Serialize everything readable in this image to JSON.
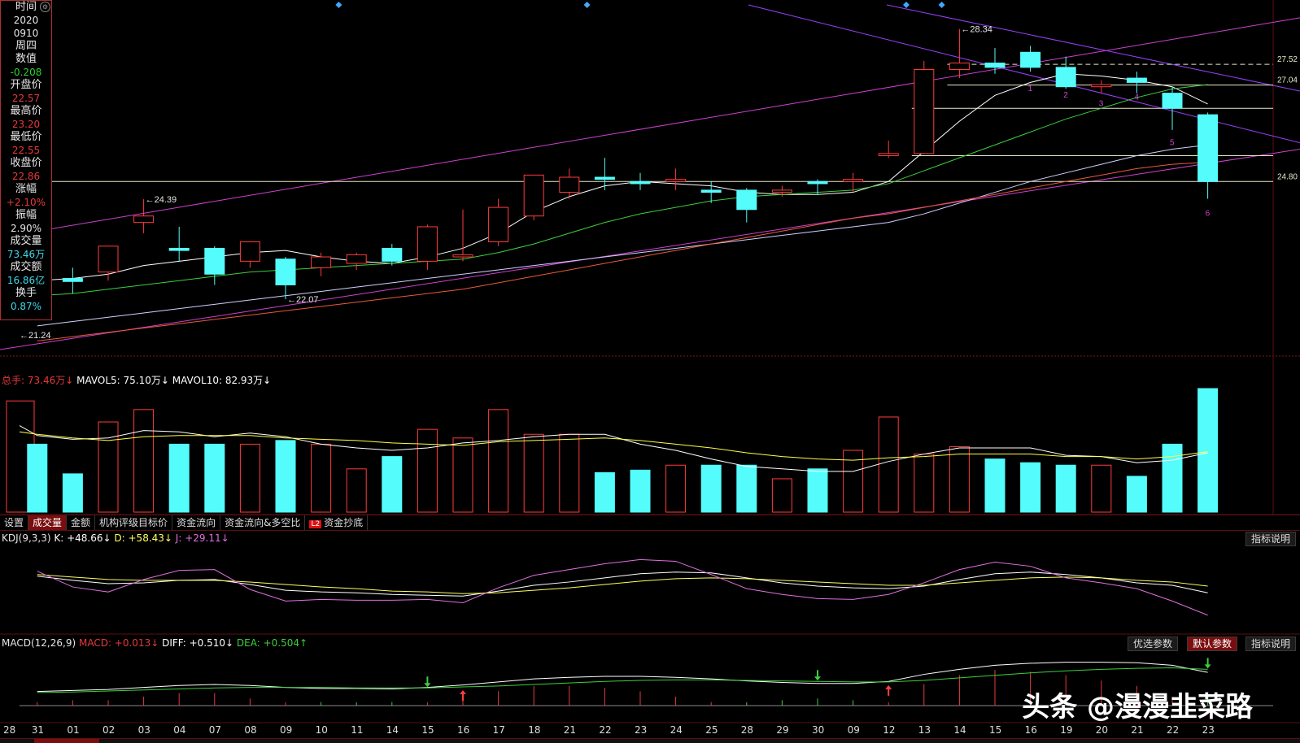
{
  "info_panel": {
    "rows": [
      {
        "label": "时间",
        "value": "2020"
      },
      {
        "label": "",
        "value": "0910"
      },
      {
        "label": "周四",
        "value": ""
      },
      {
        "label": "数值",
        "value": "-0.208"
      },
      {
        "label": "开盘价",
        "value": "22.57"
      },
      {
        "label": "最高价",
        "value": "23.20"
      },
      {
        "label": "最低价",
        "value": "22.55"
      },
      {
        "label": "收盘价",
        "value": "22.86"
      },
      {
        "label": "涨幅",
        "value": "+2.10%"
      },
      {
        "label": "振幅",
        "value": "2.90%"
      },
      {
        "label": "成交量",
        "value": "73.46万"
      },
      {
        "label": "成交额",
        "value": "16.86亿"
      },
      {
        "label": "换手",
        "value": "0.87%"
      }
    ],
    "value_colors": [
      "#e6e6e6",
      "#e6e6e6",
      "#e6e6e6",
      "#2ed52e",
      "#e53a3a",
      "#e53a3a",
      "#e53a3a",
      "#e53a3a",
      "#e53a3a",
      "#e6e6e6",
      "#3fd8e8",
      "#3fd8e8",
      "#3fd8e8"
    ]
  },
  "price_chart": {
    "y_range": [
      20.9,
      28.9
    ],
    "candles": [
      {
        "o": 22.9,
        "h": 23.6,
        "c": 22.2,
        "l": 22.0
      },
      {
        "o": 22.55,
        "h": 22.8,
        "c": 22.48,
        "l": 22.2
      },
      {
        "o": 22.7,
        "h": 23.3,
        "c": 23.3,
        "l": 22.5
      },
      {
        "o": 23.85,
        "h": 24.39,
        "c": 24.0,
        "l": 23.6
      },
      {
        "o": 23.25,
        "h": 23.75,
        "c": 23.2,
        "l": 22.95
      },
      {
        "o": 23.25,
        "h": 23.3,
        "c": 22.65,
        "l": 22.4
      },
      {
        "o": 22.95,
        "h": 23.4,
        "c": 23.4,
        "l": 22.8
      },
      {
        "o": 23.0,
        "h": 23.05,
        "c": 22.4,
        "l": 22.07
      },
      {
        "o": 22.8,
        "h": 23.15,
        "c": 23.05,
        "l": 22.6
      },
      {
        "o": 22.9,
        "h": 23.15,
        "c": 23.1,
        "l": 22.75
      },
      {
        "o": 23.25,
        "h": 23.35,
        "c": 22.95,
        "l": 22.85
      },
      {
        "o": 22.95,
        "h": 23.8,
        "c": 23.75,
        "l": 22.75
      },
      {
        "o": 23.05,
        "h": 24.15,
        "c": 23.1,
        "l": 22.95
      },
      {
        "o": 23.4,
        "h": 24.4,
        "c": 24.2,
        "l": 23.3
      },
      {
        "o": 24.0,
        "h": 24.8,
        "c": 24.95,
        "l": 23.9
      },
      {
        "o": 24.55,
        "h": 25.1,
        "c": 24.9,
        "l": 24.4
      },
      {
        "o": 24.9,
        "h": 25.35,
        "c": 24.85,
        "l": 24.6
      },
      {
        "o": 24.8,
        "h": 25.0,
        "c": 24.75,
        "l": 24.6
      },
      {
        "o": 24.8,
        "h": 25.1,
        "c": 24.85,
        "l": 24.6
      },
      {
        "o": 24.6,
        "h": 24.8,
        "c": 24.55,
        "l": 24.3
      },
      {
        "o": 24.6,
        "h": 24.65,
        "c": 24.15,
        "l": 23.85
      },
      {
        "o": 24.55,
        "h": 24.7,
        "c": 24.6,
        "l": 24.45
      },
      {
        "o": 24.8,
        "h": 24.85,
        "c": 24.75,
        "l": 24.5
      },
      {
        "o": 24.8,
        "h": 25.0,
        "c": 24.85,
        "l": 24.55
      },
      {
        "o": 25.4,
        "h": 25.75,
        "c": 25.45,
        "l": 25.35
      },
      {
        "o": 25.45,
        "h": 27.6,
        "c": 27.4,
        "l": 25.45
      },
      {
        "o": 27.4,
        "h": 28.34,
        "c": 27.55,
        "l": 27.2
      },
      {
        "o": 27.55,
        "h": 27.9,
        "c": 27.45,
        "l": 27.3
      },
      {
        "o": 27.8,
        "h": 27.95,
        "c": 27.45,
        "l": 27.35
      },
      {
        "o": 27.45,
        "h": 27.7,
        "c": 27.0,
        "l": 26.95
      },
      {
        "o": 27.0,
        "h": 27.15,
        "c": 27.05,
        "l": 26.85
      },
      {
        "o": 27.2,
        "h": 27.35,
        "c": 27.1,
        "l": 26.85
      },
      {
        "o": 26.85,
        "h": 27.0,
        "c": 26.5,
        "l": 26.0
      },
      {
        "o": 26.35,
        "h": 26.4,
        "c": 24.8,
        "l": 24.4
      }
    ],
    "ma": [
      {
        "color": "#ffffff",
        "values": [
          22.5,
          22.55,
          22.65,
          22.85,
          22.95,
          23.05,
          23.15,
          23.2,
          23.05,
          22.95,
          22.9,
          23.05,
          23.25,
          23.6,
          24.1,
          24.45,
          24.7,
          24.8,
          24.75,
          24.7,
          24.55,
          24.5,
          24.5,
          24.55,
          24.8,
          25.5,
          26.2,
          26.8,
          27.1,
          27.3,
          27.25,
          27.15,
          27.0,
          26.6
        ]
      },
      {
        "color": "#3ccf3c",
        "values": [
          22.15,
          22.2,
          22.3,
          22.4,
          22.5,
          22.6,
          22.7,
          22.75,
          22.8,
          22.85,
          22.9,
          22.95,
          23.0,
          23.15,
          23.35,
          23.6,
          23.85,
          24.05,
          24.2,
          24.35,
          24.45,
          24.5,
          24.55,
          24.6,
          24.75,
          25.05,
          25.35,
          25.65,
          25.95,
          26.25,
          26.5,
          26.75,
          26.95,
          27.05
        ]
      },
      {
        "color": "#d0d0ff",
        "values": [
          21.45,
          21.55,
          21.65,
          21.75,
          21.85,
          21.95,
          22.05,
          22.15,
          22.25,
          22.35,
          22.45,
          22.55,
          22.65,
          22.75,
          22.85,
          22.95,
          23.05,
          23.15,
          23.25,
          23.35,
          23.45,
          23.55,
          23.65,
          23.75,
          23.85,
          24.05,
          24.3,
          24.55,
          24.8,
          25.0,
          25.2,
          25.4,
          25.55,
          25.65
        ]
      },
      {
        "color": "#e85a3a",
        "values": [
          21.1,
          21.2,
          21.3,
          21.4,
          21.5,
          21.6,
          21.7,
          21.8,
          21.9,
          22.0,
          22.1,
          22.2,
          22.3,
          22.45,
          22.6,
          22.75,
          22.9,
          23.05,
          23.2,
          23.35,
          23.5,
          23.65,
          23.8,
          23.95,
          24.05,
          24.2,
          24.35,
          24.5,
          24.65,
          24.8,
          24.95,
          25.1,
          25.2,
          25.25
        ]
      }
    ],
    "extreme_labels": [
      {
        "text": "24.39",
        "index": 3,
        "price": 24.39
      },
      {
        "text": "22.07",
        "index": 7,
        "price": 22.07
      },
      {
        "text": "21.24",
        "index": -1,
        "price": 21.24
      },
      {
        "text": "28.34",
        "index": 26,
        "price": 28.34
      }
    ],
    "level_lines": [
      {
        "text": "27.52",
        "price": 27.52,
        "dashed": true,
        "start_index": 26
      },
      {
        "text": "27.04",
        "price": 27.04,
        "dashed": false,
        "start_index": 26
      },
      {
        "text": "",
        "price": 26.5,
        "dashed": false,
        "start_index": 25
      },
      {
        "text": "",
        "price": 25.4,
        "dashed": false,
        "start_index": 25
      },
      {
        "text": "24.80",
        "price": 24.8,
        "dashed": false,
        "start_index": 0
      }
    ],
    "wave_labels": [
      {
        "text": "1",
        "index": 28,
        "price": 26.9
      },
      {
        "text": "2",
        "index": 29,
        "price": 26.75
      },
      {
        "text": "3",
        "index": 30,
        "price": 26.55
      },
      {
        "text": "4",
        "index": 31,
        "price": 26.7
      },
      {
        "text": "5",
        "index": 32,
        "price": 25.65
      },
      {
        "text": "6",
        "index": 33,
        "price": 24.0
      }
    ],
    "diamonds_index": [
      8.5,
      15.5,
      24.5,
      25.5
    ]
  },
  "volume_panel": {
    "header": {
      "total_label": "总手: ",
      "total_value": "73.46万↓",
      "mavol5": "MAVOL5: 75.10万↓",
      "mavol10": "MAVOL10: 82.93万↓"
    },
    "max": 100,
    "values": [
      90,
      55,
      31,
      73,
      83,
      55,
      55,
      55,
      58,
      55,
      35,
      45,
      67,
      60,
      83,
      63,
      63,
      32,
      34,
      38,
      38,
      38,
      27,
      35,
      50,
      77,
      47,
      53,
      43,
      40,
      38,
      38,
      29,
      55,
      100
    ],
    "ma5": [
      70,
      62,
      59,
      60,
      66,
      65,
      61,
      64,
      61,
      55,
      52,
      50,
      52,
      56,
      58,
      61,
      63,
      63,
      55,
      50,
      43,
      37,
      35,
      33,
      33,
      41,
      47,
      52,
      52,
      52,
      46,
      45,
      40,
      42,
      48
    ],
    "ma10": [
      65,
      63,
      60,
      58,
      61,
      62,
      62,
      62,
      60,
      59,
      58,
      56,
      55,
      54,
      57,
      58,
      59,
      60,
      58,
      55,
      52,
      48,
      45,
      43,
      42,
      44,
      45,
      47,
      47,
      47,
      45,
      45,
      43,
      45,
      49
    ]
  },
  "tabs": {
    "items": [
      "设置",
      "成交量",
      "金额",
      "机构评级目标价",
      "资金流向",
      "资金流向&多空比",
      "资金抄底"
    ],
    "active_index": 1,
    "l2_badge": "L2"
  },
  "kdj_panel": {
    "header": {
      "name": "KDJ(9,3,3)",
      "k": "K: +48.66↓",
      "d": "D: +58.43↓",
      "j": "J: +29.11↓"
    },
    "explain_btn": "指标说明",
    "k": [
      60,
      55,
      51,
      52,
      55,
      56,
      50,
      43,
      41,
      40,
      38,
      37,
      36,
      42,
      49,
      53,
      58,
      63,
      65,
      64,
      58,
      52,
      48,
      46,
      45,
      48,
      56,
      63,
      65,
      62,
      58,
      52,
      49,
      40
    ],
    "d": [
      62,
      59,
      56,
      55,
      55,
      55,
      53,
      50,
      47,
      45,
      42,
      41,
      39,
      40,
      43,
      46,
      50,
      54,
      57,
      58,
      57,
      55,
      53,
      51,
      49,
      49,
      52,
      55,
      58,
      59,
      58,
      55,
      53,
      48
    ],
    "j": [
      66,
      47,
      41,
      56,
      67,
      68,
      44,
      30,
      32,
      31,
      31,
      32,
      28,
      46,
      61,
      68,
      75,
      80,
      78,
      62,
      45,
      38,
      33,
      32,
      38,
      52,
      68,
      77,
      72,
      58,
      52,
      45,
      30,
      13
    ],
    "range": [
      0,
      100
    ]
  },
  "macd_panel": {
    "header": {
      "name": "MACD(12,26,9)",
      "macd": "MACD: +0.013↓",
      "diff": "DIFF: +0.510↓",
      "dea": "DEA: +0.504↑"
    },
    "buttons": {
      "preferred": "优选参数",
      "default": "默认参数",
      "explain": "指标说明"
    },
    "diff": [
      0.28,
      0.3,
      0.32,
      0.36,
      0.4,
      0.42,
      0.4,
      0.36,
      0.34,
      0.34,
      0.33,
      0.36,
      0.41,
      0.47,
      0.53,
      0.56,
      0.58,
      0.58,
      0.56,
      0.53,
      0.49,
      0.46,
      0.44,
      0.44,
      0.48,
      0.62,
      0.72,
      0.8,
      0.84,
      0.86,
      0.86,
      0.85,
      0.8,
      0.66
    ],
    "dea": [
      0.26,
      0.27,
      0.29,
      0.31,
      0.33,
      0.35,
      0.36,
      0.36,
      0.36,
      0.35,
      0.35,
      0.35,
      0.37,
      0.39,
      0.42,
      0.45,
      0.48,
      0.5,
      0.51,
      0.51,
      0.5,
      0.49,
      0.48,
      0.47,
      0.47,
      0.5,
      0.55,
      0.6,
      0.65,
      0.69,
      0.72,
      0.74,
      0.75,
      0.72
    ],
    "range": [
      0.0,
      1.0
    ],
    "down_arrows": [
      11,
      22,
      33
    ],
    "up_arrows": [
      12,
      24
    ]
  },
  "date_axis": {
    "labels": [
      "28",
      "31",
      "01",
      "02",
      "03",
      "04",
      "07",
      "08",
      "09",
      "10",
      "11",
      "14",
      "15",
      "16",
      "17",
      "18",
      "21",
      "22",
      "23",
      "24",
      "25",
      "28",
      "29",
      "30",
      "09",
      "12",
      "13",
      "14",
      "15",
      "16",
      "19",
      "20",
      "21",
      "22",
      "23"
    ]
  },
  "watermark": "头条 @漫漫韭菜路",
  "colors": {
    "up": "#ff3b3b",
    "down": "#54fcfc",
    "ma5": "#ffffff",
    "ma10": "#ffff40"
  }
}
